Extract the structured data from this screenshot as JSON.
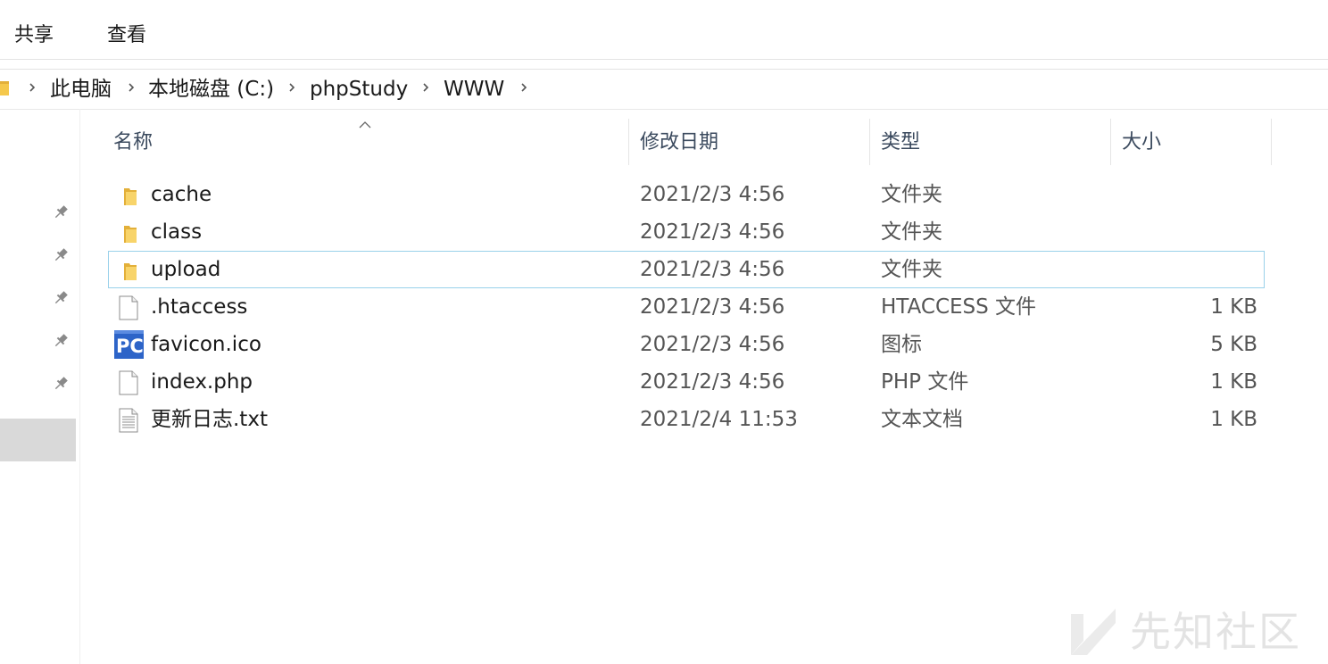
{
  "ribbon": {
    "tabs": [
      {
        "label": "共享"
      },
      {
        "label": "查看"
      }
    ]
  },
  "breadcrumb": {
    "items": [
      "此电脑",
      "本地磁盘 (C:)",
      "phpStudy",
      "WWW"
    ]
  },
  "columns": {
    "name": "名称",
    "modified": "修改日期",
    "type": "类型",
    "size": "大小"
  },
  "files": [
    {
      "name": "cache",
      "modified": "2021/2/3 4:56",
      "type": "文件夹",
      "size": "",
      "icon": "folder-icon"
    },
    {
      "name": "class",
      "modified": "2021/2/3 4:56",
      "type": "文件夹",
      "size": "",
      "icon": "folder-icon"
    },
    {
      "name": "upload",
      "modified": "2021/2/3 4:56",
      "type": "文件夹",
      "size": "",
      "icon": "folder-icon",
      "selected": true
    },
    {
      "name": ".htaccess",
      "modified": "2021/2/3 4:56",
      "type": "HTACCESS 文件",
      "size": "1 KB",
      "icon": "file-icon"
    },
    {
      "name": "favicon.ico",
      "modified": "2021/2/3 4:56",
      "type": "图标",
      "size": "5 KB",
      "icon": "phpstudy-icon"
    },
    {
      "name": "index.php",
      "modified": "2021/2/3 4:56",
      "type": "PHP 文件",
      "size": "1 KB",
      "icon": "file-icon"
    },
    {
      "name": "更新日志.txt",
      "modified": "2021/2/4 11:53",
      "type": "文本文档",
      "size": "1 KB",
      "icon": "text-file-icon"
    }
  ],
  "watermark": {
    "text": "先知社区"
  },
  "colors": {
    "selection_border": "#99d1ea",
    "header_text": "#3b4a5e",
    "folder": "#f5c84c"
  }
}
